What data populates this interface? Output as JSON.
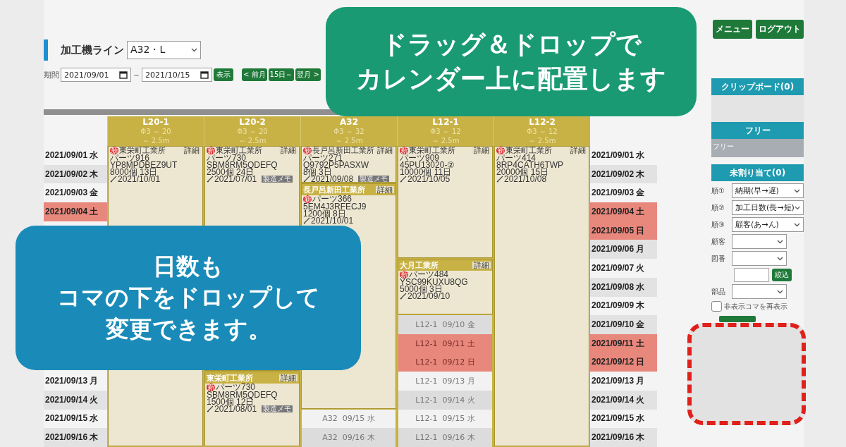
{
  "header": {
    "line_label": "加工機ライン",
    "line_value": "A32・L",
    "period_label": "期間",
    "date_from": "2021/09/01",
    "date_sep": "～",
    "date_to": "2021/10/15",
    "show_button": "表示",
    "nav_buttons": [
      "< 前月",
      "15日～",
      "翌月 >"
    ]
  },
  "dates": [
    {
      "left": "2021/09/01 水",
      "right": "2021/09/01 水",
      "holiday": false
    },
    {
      "left": "2021/09/02 木",
      "right": "2021/09/02 木",
      "holiday": false
    },
    {
      "left": "2021/09/03 金",
      "right": "2021/09/03 金",
      "holiday": false
    },
    {
      "left": "2021/09/04 土",
      "right": "2021/09/04 土",
      "holiday": true
    },
    {
      "right": "2021/09/05 日",
      "holiday": true
    },
    {
      "right": "2021/09/06 月",
      "holiday": false
    },
    {
      "right": "2021/09/07 火",
      "holiday": false
    },
    {
      "right": "2021/09/08 水",
      "holiday": false
    },
    {
      "right": "2021/09/09 木",
      "holiday": false
    },
    {
      "right": "2021/09/10 金",
      "holiday": false
    },
    {
      "right": "2021/09/11 土",
      "holiday": true
    },
    {
      "right": "2021/09/12 日",
      "holiday": true
    },
    {
      "left": "2021/09/13 月",
      "right": "2021/09/13 月",
      "holiday": false
    },
    {
      "left": "2021/09/14 火",
      "right": "2021/09/14 火",
      "holiday": false
    },
    {
      "left": "2021/09/15 水",
      "right": "2021/09/15 水",
      "holiday": false
    },
    {
      "left": "2021/09/16 木",
      "right": "2021/09/16 木",
      "holiday": false
    }
  ],
  "lines": [
    {
      "name": "L20-1",
      "spec1": "Φ3 ～ 20",
      "spec2": "～ 2.5m",
      "cells": [
        {
          "kind": "card",
          "headed": false,
          "company": "東栄町工業所",
          "badge": "新",
          "part": "パーツ916",
          "code": "YP8MPDBEZ9UT",
          "qty": "8000個 13日",
          "due": "2021/10/01",
          "detail": "詳細"
        },
        {
          "kind": "cont"
        },
        {
          "kind": "cont"
        },
        {
          "kind": "cont"
        },
        {
          "kind": "cont"
        },
        {
          "kind": "cont"
        },
        {
          "kind": "cont"
        },
        {
          "kind": "cont"
        },
        {
          "kind": "cont"
        },
        {
          "kind": "cont"
        },
        {
          "kind": "cont"
        },
        {
          "kind": "cont"
        },
        {
          "kind": "cont"
        },
        {
          "kind": "cont"
        },
        {
          "kind": "cont"
        },
        {
          "kind": "cont"
        }
      ]
    },
    {
      "name": "L20-2",
      "spec1": "Φ3 ～ 20",
      "spec2": "～ 2.5m",
      "cells": [
        {
          "kind": "card",
          "headed": false,
          "company": "東栄町工業所",
          "badge": "新",
          "part": "パーツ730",
          "code": "SBM8RM5QDEFQ",
          "qty": "2500個 24日",
          "due": "2021/07/01",
          "memo": "製造メモ",
          "detail": "詳細"
        },
        {
          "kind": "cont"
        },
        {
          "kind": "cont"
        },
        {
          "kind": "cont"
        },
        {
          "kind": "cont"
        },
        {
          "kind": "cont"
        },
        {
          "kind": "cont"
        },
        {
          "kind": "cont"
        },
        {
          "kind": "cont"
        },
        {
          "kind": "cont"
        },
        {
          "kind": "cont"
        },
        {
          "kind": "cont"
        },
        {
          "kind": "card",
          "headed": true,
          "company": "東栄町工業所",
          "badge": "新",
          "part": "パーツ730",
          "code": "SBM8RM5QDEFQ",
          "qty": "1500個 12日",
          "due": "2021/08/01",
          "memo": "製造メモ",
          "detail": "詳細"
        },
        {
          "kind": "cont"
        },
        {
          "kind": "cont"
        },
        {
          "kind": "cont"
        }
      ]
    },
    {
      "name": "A32",
      "spec1": "Φ3 ～ 32",
      "spec2": "～ 2.5m",
      "cells": [
        {
          "kind": "card",
          "headed": false,
          "company": "長戸呂新田工業所",
          "badge": "新",
          "part": "パーツ271",
          "code": "Q9792P5PASXW",
          "qty": "8個 3日",
          "due": "2021/09/08",
          "memo": "製造メモ",
          "detail": "詳細"
        },
        {
          "kind": "cont"
        },
        {
          "kind": "card",
          "headed": true,
          "company": "長戸呂新田工業所",
          "badge": "新",
          "part": "パーツ366",
          "code": "5EM4J3RFECJ9",
          "qty": "1200個 8日",
          "due": "2021/10/01",
          "detail": "詳細"
        },
        {
          "kind": "cont"
        },
        {
          "kind": "cont"
        },
        {
          "kind": "cont"
        },
        {
          "kind": "cont"
        },
        {
          "kind": "cont"
        },
        {
          "kind": "cont"
        },
        {
          "kind": "cont"
        },
        {
          "kind": "cont"
        },
        {
          "kind": "cont"
        },
        {
          "kind": "cont"
        },
        {
          "kind": "cont"
        },
        {
          "kind": "empty",
          "label": "A32  09/15 水",
          "holiday": false
        },
        {
          "kind": "empty",
          "label": "A32  09/16 木",
          "holiday": false
        }
      ]
    },
    {
      "name": "L12-1",
      "spec1": "Φ3 ～ 12",
      "spec2": "～ 2.5m",
      "cells": [
        {
          "kind": "card",
          "headed": false,
          "company": "東栄町工業所",
          "badge": "新",
          "part": "パーツ909",
          "code": "45PU13020-②",
          "qty": "10000個 11日",
          "due": "2021/10/05",
          "detail": "詳細"
        },
        {
          "kind": "cont"
        },
        {
          "kind": "cont"
        },
        {
          "kind": "cont"
        },
        {
          "kind": "cont"
        },
        {
          "kind": "cont"
        },
        {
          "kind": "card",
          "headed": true,
          "company": "大月工業所",
          "badge": "新",
          "part": "パーツ484",
          "code": "YSC99KUXU8QG",
          "qty": "5000個 3日",
          "due": "2021/09/10",
          "detail": "詳細"
        },
        {
          "kind": "cont"
        },
        {
          "kind": "cont"
        },
        {
          "kind": "empty",
          "label": "L12-1  09/10 金",
          "holiday": false
        },
        {
          "kind": "empty",
          "label": "L12-1  09/11 土",
          "holiday": true
        },
        {
          "kind": "empty",
          "label": "L12-1  09/12 日",
          "holiday": true
        },
        {
          "kind": "empty",
          "label": "L12-1  09/13 月",
          "holiday": false
        },
        {
          "kind": "empty",
          "label": "L12-1  09/14 火",
          "holiday": false
        },
        {
          "kind": "empty",
          "label": "L12-1  09/15 水",
          "holiday": false
        },
        {
          "kind": "empty",
          "label": "L12-1  09/16 木",
          "holiday": false
        }
      ]
    },
    {
      "name": "L12-2",
      "spec1": "Φ3 ～ 12",
      "spec2": "～ 2.5m",
      "cells": [
        {
          "kind": "card",
          "headed": false,
          "company": "東栄町工業所",
          "badge": "新",
          "part": "パーツ414",
          "code": "8RP4CATH6TWP",
          "qty": "20000個 15日",
          "due": "2021/10/08",
          "detail": "詳細"
        },
        {
          "kind": "cont"
        },
        {
          "kind": "cont"
        },
        {
          "kind": "cont"
        },
        {
          "kind": "cont"
        },
        {
          "kind": "cont"
        },
        {
          "kind": "cont"
        },
        {
          "kind": "cont"
        },
        {
          "kind": "cont"
        },
        {
          "kind": "cont"
        },
        {
          "kind": "cont"
        },
        {
          "kind": "cont"
        },
        {
          "kind": "cont"
        },
        {
          "kind": "cont"
        },
        {
          "kind": "cont"
        },
        {
          "kind": "cont"
        }
      ]
    }
  ],
  "sidebar": {
    "buttons": [
      "メニュー",
      "ログアウト"
    ],
    "clipboard": "クリップボード(0)",
    "free_title": "フリー",
    "free_items": [
      "フリー"
    ],
    "unassigned": "未割り当て(0)",
    "sorts": [
      {
        "label": "順①",
        "value": "納期(早→遅)"
      },
      {
        "label": "順②",
        "value": "加工日数(長→短)"
      },
      {
        "label": "順③",
        "value": "顧客(あ→ん)"
      }
    ],
    "filters": [
      {
        "kind": "select",
        "label": "顧客"
      },
      {
        "kind": "select",
        "label": "図番"
      },
      {
        "kind": "input",
        "button": "絞込"
      },
      {
        "kind": "select",
        "label": "部品"
      }
    ],
    "show_hidden": {
      "label": "非表示コマを再表示",
      "checked": false
    }
  },
  "callouts": [
    {
      "kind": "green",
      "lines": [
        "ドラッグ＆ドロップで",
        "カレンダー上に配置します"
      ]
    },
    {
      "kind": "blue",
      "lines": [
        "日数も",
        "コマの下をドロップして",
        "変更できます。"
      ]
    }
  ]
}
